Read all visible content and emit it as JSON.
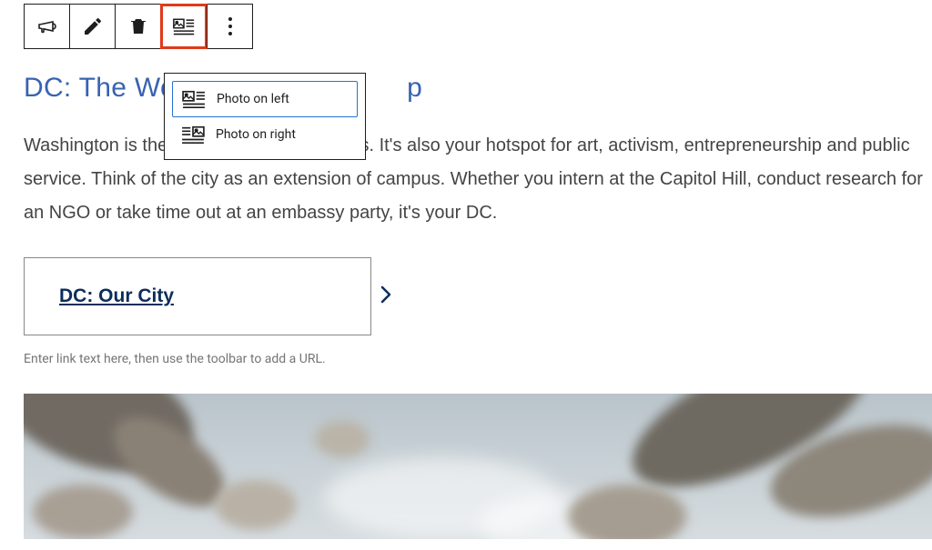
{
  "toolbar": {
    "icons": {
      "announce": "megaphone-icon",
      "edit": "pencil-icon",
      "delete": "trash-icon",
      "layout": "photo-layout-icon",
      "more": "more-icon"
    }
  },
  "dropdown": {
    "option_left": "Photo on left",
    "option_right": "Photo on right"
  },
  "heading_prefix": "DC: The Wo",
  "heading_suffix": "p",
  "body_prefix": "Washington is the",
  "body_suffix": "cs. It's also your hotspot for art, activism, entrepreneurship and public service. Think of the city as an extension of campus. Whether you intern at the Capitol Hill, conduct research for an NGO or take time out at an embassy party, it's your DC.",
  "link_card": {
    "label": "DC: Our City"
  },
  "helper": "Enter link text here, then use the toolbar to add a URL."
}
